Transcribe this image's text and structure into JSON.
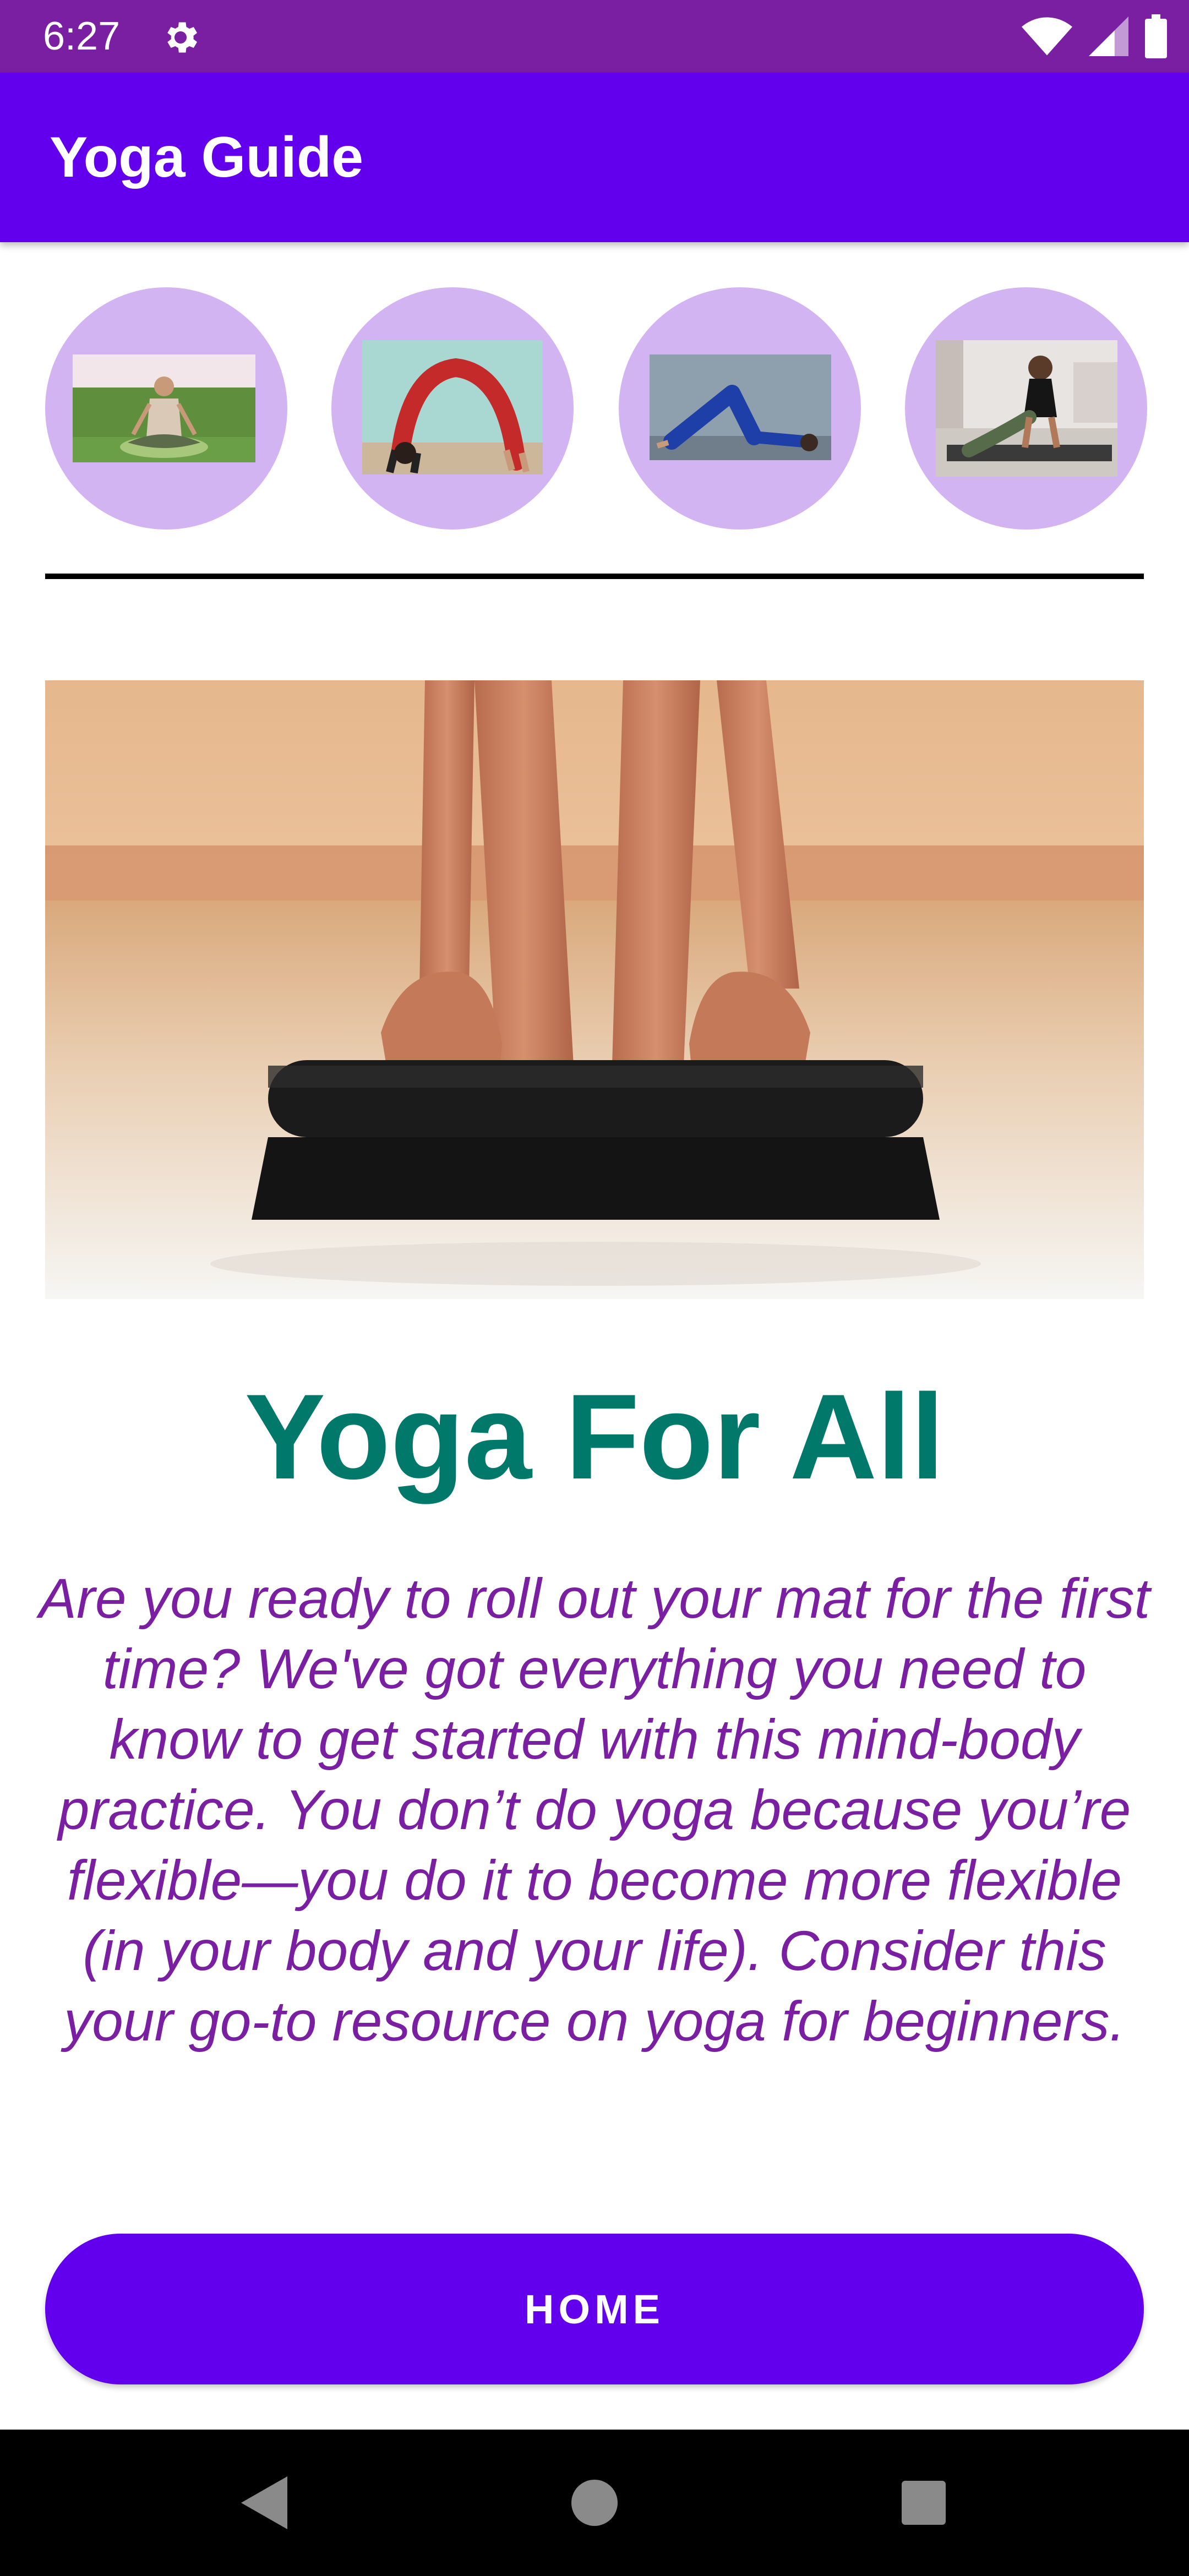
{
  "status_bar": {
    "time": "6:27",
    "icons": [
      "settings-gear-icon",
      "wifi-icon",
      "cellular-signal-icon",
      "battery-icon"
    ]
  },
  "app_bar": {
    "title": "Yoga Guide"
  },
  "poses": [
    {
      "name": "seated-meditation-pose"
    },
    {
      "name": "wheel-backbend-pose"
    },
    {
      "name": "plow-pose"
    },
    {
      "name": "cobra-pose"
    }
  ],
  "hero": {
    "image": "hands-rolling-yoga-mat"
  },
  "content": {
    "heading": "Yoga For All",
    "body": "Are you ready to roll out your mat for the first time? We've got everything you need to know to get started with this mind-body practice. You don’t do yoga because you’re flexible—you do it to become more flexible (in your body and your life). Consider this your go-to resource on yoga for beginners."
  },
  "actions": {
    "home_label": "HOME"
  },
  "nav_bar": {
    "buttons": [
      "back-icon",
      "home-circle-icon",
      "recents-square-icon"
    ]
  },
  "colors": {
    "status_bar": "#7a1fa2",
    "app_bar": "#6200ee",
    "thumb_bg": "#d3b4f2",
    "heading": "#00796b",
    "body_text": "#7b1fa2",
    "button": "#6200ee"
  }
}
